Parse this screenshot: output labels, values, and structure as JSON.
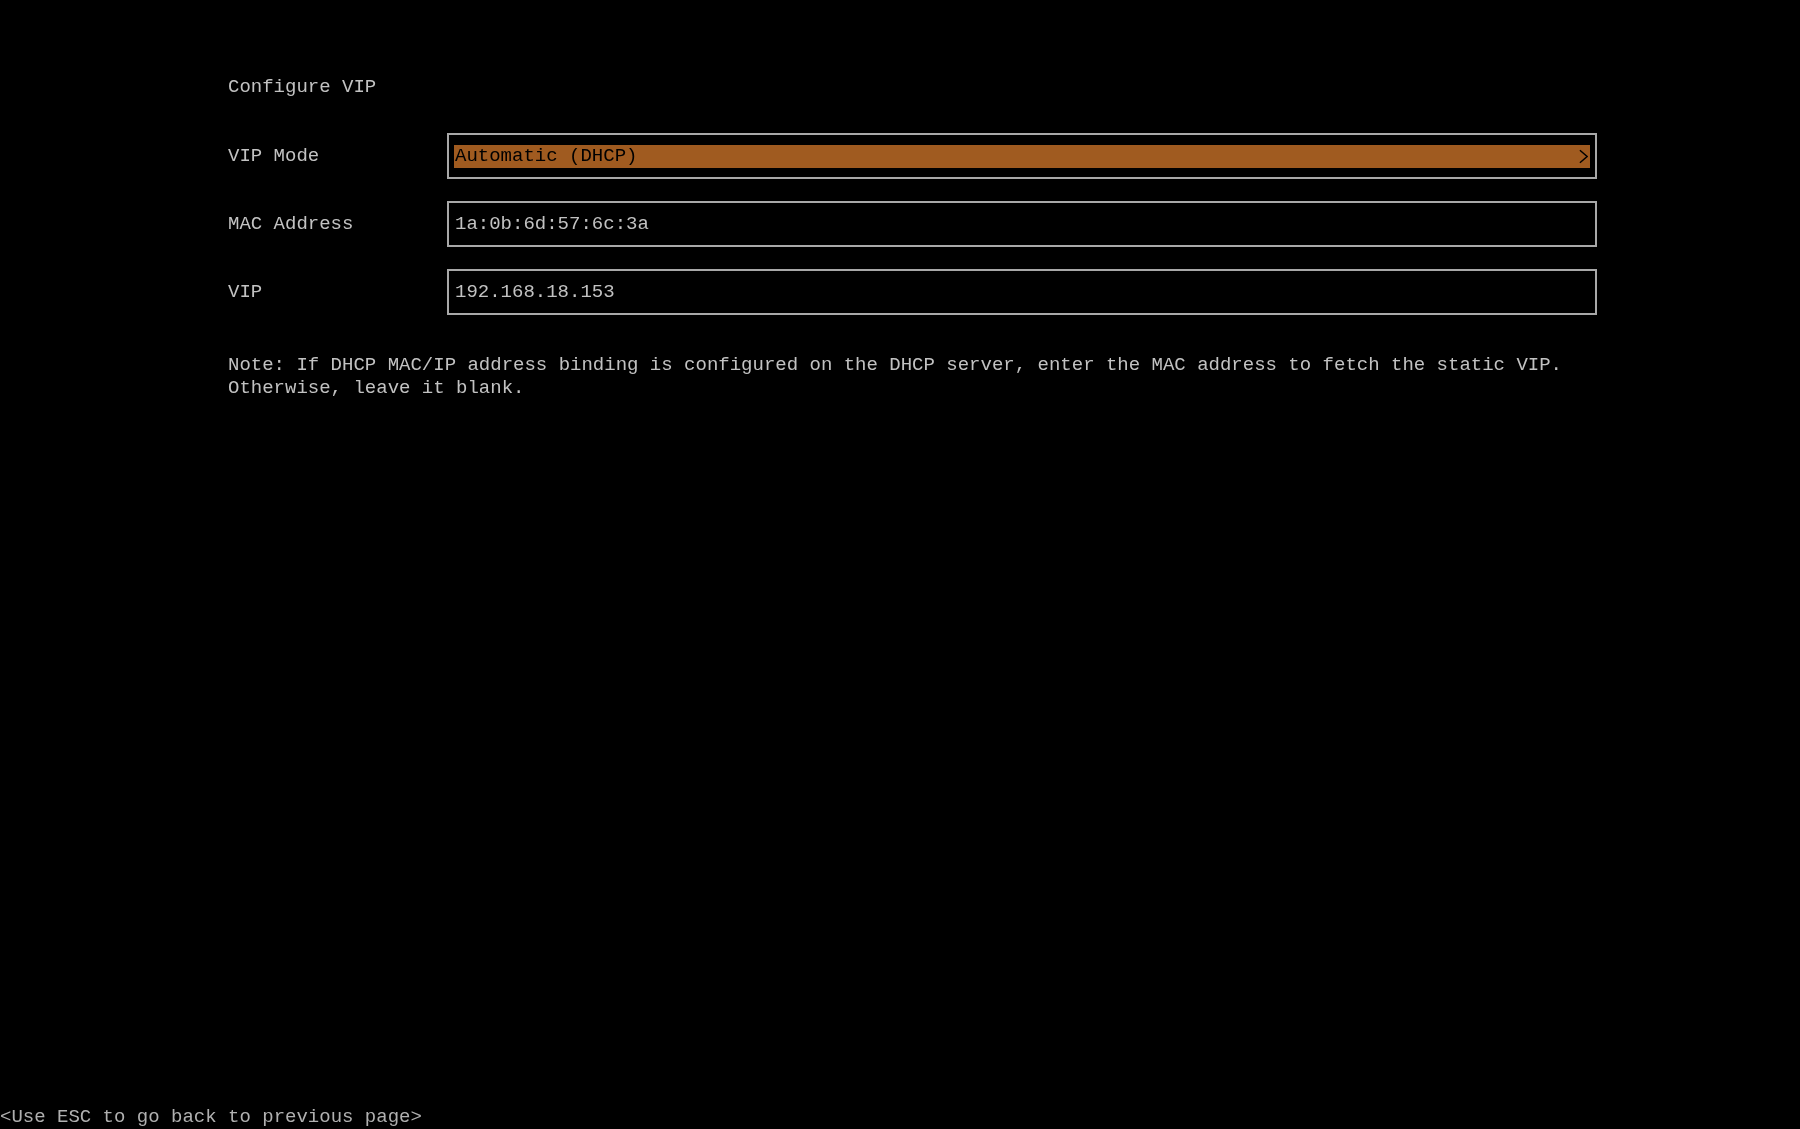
{
  "screen": {
    "title": "Configure VIP"
  },
  "fields": [
    {
      "kind": "select",
      "label": "VIP Mode",
      "value": "Automatic (DHCP)",
      "selected": true
    },
    {
      "kind": "input",
      "label": "MAC Address",
      "value": "1a:0b:6d:57:6c:3a",
      "selected": false
    },
    {
      "kind": "input",
      "label": "VIP",
      "value": "192.168.18.153",
      "selected": false
    }
  ],
  "note": "Note: If DHCP MAC/IP address binding is configured on the DHCP server, enter the MAC address to fetch the static VIP. Otherwise, leave it blank.",
  "footer_hint": "<Use ESC to go back to previous page>"
}
